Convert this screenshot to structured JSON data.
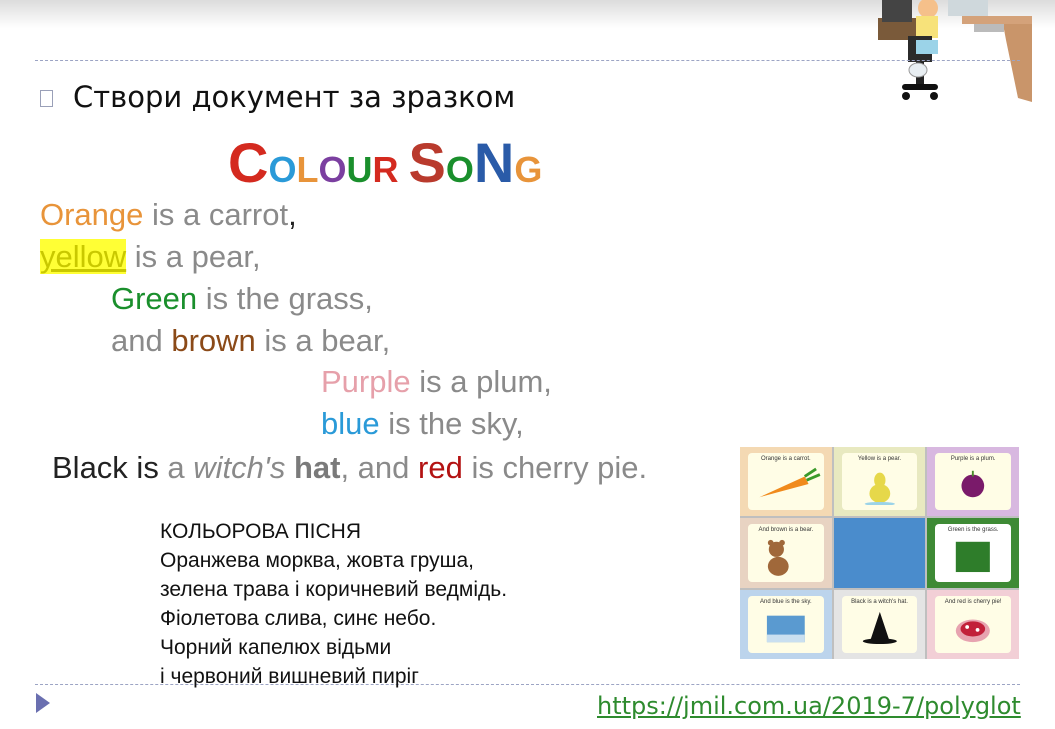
{
  "slide": {
    "bullet_text": "Створи документ за зразком",
    "title_letters": [
      {
        "ch": "C",
        "color": "#d42a1f",
        "size": "big"
      },
      {
        "ch": "OLOUR",
        "colors": [
          "#2a9ad8",
          "#e8943a",
          "#7b3fa0",
          "#1a8f2c",
          "#d42a1f"
        ],
        "size": "small"
      },
      {
        "ch": " ",
        "color": "#000",
        "size": "small"
      },
      {
        "ch": "S",
        "color": "#b93a2d",
        "size": "big"
      },
      {
        "ch": "O",
        "color": "#1a8f2c",
        "size": "small"
      },
      {
        "ch": "N",
        "color": "#2a5ba8",
        "size": "big"
      },
      {
        "ch": "G",
        "color": "#e8943a",
        "size": "small"
      }
    ],
    "title_text": "COLOUR SONG",
    "poem": {
      "l1_a": "Orange",
      "l1_b": " is a carrot",
      "l1_c": ",",
      "l2_a": "yellow",
      "l2_b": " is a pear,",
      "l3_a": "Green",
      "l3_b": " is the grass,",
      "l4_a": "and ",
      "l4_b": "brown",
      "l4_c": " is a bear,",
      "l5_a": "Purple",
      "l5_b": " is a plum,",
      "l6_a": "blue",
      "l6_b": " is the sky,",
      "l7_a": "Black",
      "l7_b": " is",
      "l7_c": " a ",
      "l7_d": "witch's",
      "l7_e": " hat",
      "l7_f": ", and ",
      "l7_g": "red",
      "l7_h": " is cherry pie."
    },
    "translation": [
      "КОЛЬОРОВА ПІСНЯ",
      "Оранжева морква, жовта груша,",
      "зелена трава і коричневий ведмідь.",
      "Фіолетова слива, синє небо.",
      "Чорний капелюх відьми",
      "і червоний вишневий пиріг"
    ],
    "grid_cards": [
      {
        "label": "Orange is a carrot.",
        "art": "carrot-icon"
      },
      {
        "label": "Yellow is a pear.",
        "art": "pear-icon"
      },
      {
        "label": "Purple is a plum.",
        "art": "plum-icon"
      },
      {
        "label": "And brown is a bear.",
        "art": "bear-icon"
      },
      {
        "label": "",
        "art": "blue-square"
      },
      {
        "label": "Green is the grass.",
        "art": "grass-icon"
      },
      {
        "label": "And blue is the sky.",
        "art": "sky-icon"
      },
      {
        "label": "Black is a witch's hat.",
        "art": "witch-hat-icon"
      },
      {
        "label": "And red is cherry pie!",
        "art": "pie-icon"
      }
    ],
    "url": "https://jmil.com.ua/2019-7/polyglot",
    "colors": {
      "orange": "#e8943a",
      "yellow": "#c9c800",
      "green": "#1a8f2c",
      "brown": "#8b4a18",
      "purple": "#e6a0aa",
      "blue": "#2a9ad8",
      "black": "#222222",
      "red": "#b31212",
      "dash": "#9ca4c4",
      "link": "#2e8b2e"
    }
  }
}
